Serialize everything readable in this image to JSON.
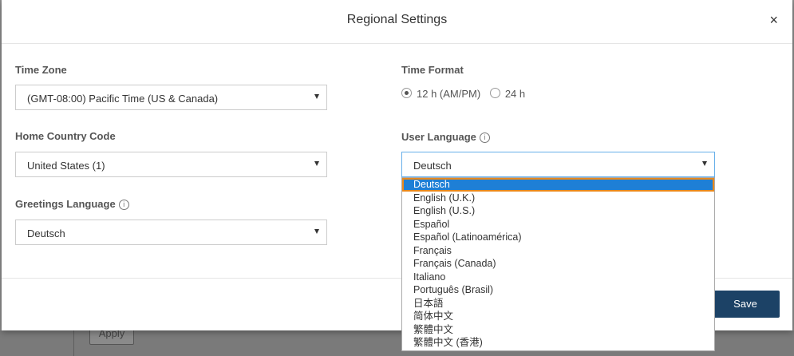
{
  "dialog": {
    "title": "Regional Settings",
    "close_glyph": "×"
  },
  "time_zone": {
    "label": "Time Zone",
    "value": "(GMT-08:00) Pacific Time (US & Canada)"
  },
  "home_country_code": {
    "label": "Home Country Code",
    "value": "United States (1)"
  },
  "greetings_language": {
    "label": "Greetings Language",
    "value": "Deutsch",
    "info_glyph": "i"
  },
  "time_format": {
    "label": "Time Format",
    "options": [
      {
        "label": "12 h (AM/PM)",
        "checked": true
      },
      {
        "label": "24 h",
        "checked": false
      }
    ]
  },
  "user_language": {
    "label": "User Language",
    "value": "Deutsch",
    "info_glyph": "i",
    "options": [
      "Deutsch",
      "English (U.K.)",
      "English (U.S.)",
      "Español",
      "Español (Latinoamérica)",
      "Français",
      "Français (Canada)",
      "Italiano",
      "Português (Brasil)",
      "日本語",
      "简体中文",
      "繁體中文",
      "繁體中文 (香港)"
    ],
    "highlighted_index": 0
  },
  "footer": {
    "save_label": "Save"
  },
  "background": {
    "apply_label": "Apply"
  },
  "colors": {
    "primary_button": "#1c4266",
    "highlight": "#1e7fd6",
    "focus_outline": "#e8891d"
  }
}
